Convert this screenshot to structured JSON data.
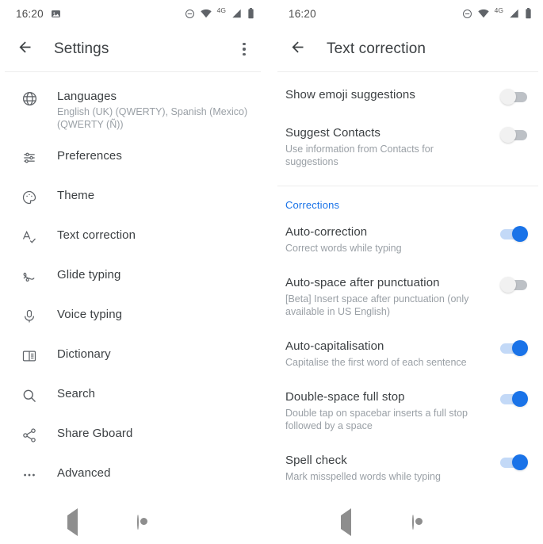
{
  "left_screen": {
    "status_bar": {
      "clock": "16:20",
      "left_icons": [
        "image-icon"
      ],
      "right_icons": [
        "do-not-disturb-icon",
        "wifi-icon",
        "signal-icon",
        "battery-icon"
      ],
      "network_label": "4G"
    },
    "app_bar": {
      "title": "Settings",
      "back_icon": "arrow-back-icon",
      "overflow_icon": "more-vert-icon"
    },
    "items": [
      {
        "icon": "globe-icon",
        "title": "Languages",
        "subtitle": "English (UK) (QWERTY), Spanish (Mexico) (QWERTY (Ñ))"
      },
      {
        "icon": "tune-icon",
        "title": "Preferences",
        "subtitle": ""
      },
      {
        "icon": "palette-icon",
        "title": "Theme",
        "subtitle": ""
      },
      {
        "icon": "spellcheck-icon",
        "title": "Text correction",
        "subtitle": ""
      },
      {
        "icon": "gesture-icon",
        "title": "Glide typing",
        "subtitle": ""
      },
      {
        "icon": "microphone-icon",
        "title": "Voice typing",
        "subtitle": ""
      },
      {
        "icon": "dictionary-icon",
        "title": "Dictionary",
        "subtitle": ""
      },
      {
        "icon": "search-icon",
        "title": "Search",
        "subtitle": ""
      },
      {
        "icon": "share-icon",
        "title": "Share Gboard",
        "subtitle": ""
      },
      {
        "icon": "more-horiz-icon",
        "title": "Advanced",
        "subtitle": ""
      }
    ],
    "nav_bar": {
      "back": "nav-back-icon",
      "home": "nav-home-icon",
      "recents": "nav-recents-icon"
    }
  },
  "right_screen": {
    "status_bar": {
      "clock": "16:20",
      "left_icons": [],
      "right_icons": [
        "do-not-disturb-icon",
        "wifi-icon",
        "signal-icon",
        "battery-icon"
      ],
      "network_label": "4G"
    },
    "app_bar": {
      "title": "Text correction",
      "back_icon": "arrow-back-icon"
    },
    "top_items": [
      {
        "title": "Show emoji suggestions",
        "subtitle": "",
        "toggle": "off"
      },
      {
        "title": "Suggest Contacts",
        "subtitle": "Use information from Contacts for suggestions",
        "toggle": "off"
      }
    ],
    "section": {
      "header": "Corrections",
      "items": [
        {
          "title": "Auto-correction",
          "subtitle": "Correct words while typing",
          "toggle": "on"
        },
        {
          "title": "Auto-space after punctuation",
          "subtitle": "[Beta] Insert space after punctuation (only available in US English)",
          "toggle": "off"
        },
        {
          "title": "Auto-capitalisation",
          "subtitle": "Capitalise the first word of each sentence",
          "toggle": "on"
        },
        {
          "title": "Double-space full stop",
          "subtitle": "Double tap on spacebar inserts a full stop followed by a space",
          "toggle": "on"
        },
        {
          "title": "Spell check",
          "subtitle": "Mark misspelled words while typing",
          "toggle": "on"
        }
      ]
    },
    "nav_bar": {
      "back": "nav-back-icon",
      "home": "nav-home-icon",
      "recents": "nav-recents-icon"
    }
  },
  "colors": {
    "accent": "#1a73e8",
    "accent_track": "#c3d9f7",
    "title_text": "#3c4043",
    "subtitle_text": "#9aa0a6",
    "icon": "#5f6368",
    "divider": "#ededed",
    "nav_icon": "#8e8e8e",
    "toggle_off_track": "#bdc1c6",
    "toggle_off_knob": "#f1f1f1"
  }
}
